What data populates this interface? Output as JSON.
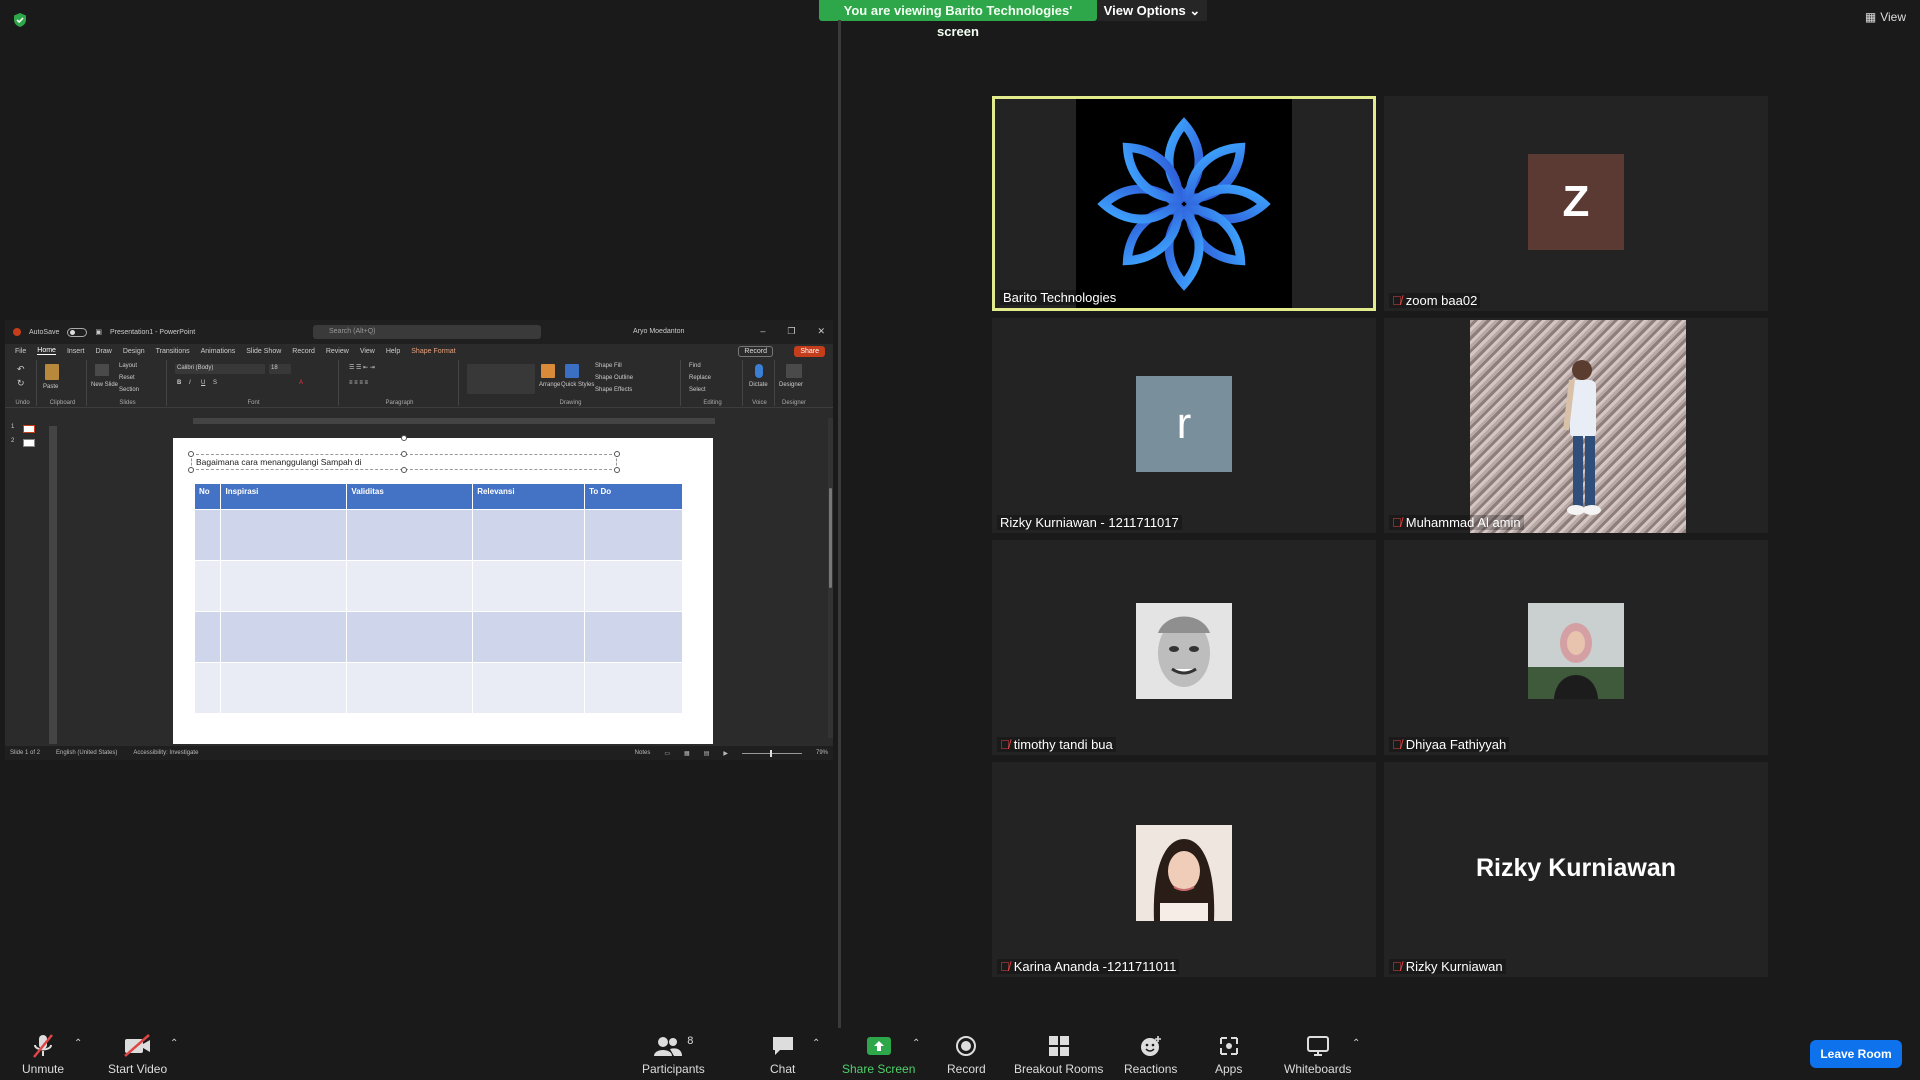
{
  "top": {
    "banner": "You are viewing Barito Technologies' screen",
    "view_options": "View Options",
    "view": "View"
  },
  "ppt": {
    "autosave": "AutoSave",
    "toggle": "Off",
    "doc_title": "Presentation1 - PowerPoint",
    "search_placeholder": "Search (Alt+Q)",
    "user": "Aryo Moedanton",
    "menu": [
      "File",
      "Home",
      "Insert",
      "Draw",
      "Design",
      "Transitions",
      "Animations",
      "Slide Show",
      "Record",
      "Review",
      "View",
      "Help",
      "Shape Format"
    ],
    "record_btn": "Record",
    "share_btn": "Share",
    "ribbon": {
      "undo": "Undo",
      "clipboard": "Clipboard",
      "paste": "Paste",
      "new_slide": "New Slide",
      "layout": "Layout",
      "reset": "Reset",
      "section": "Section",
      "slides": "Slides",
      "font_name": "Calibri (Body)",
      "font_size": "18",
      "font": "Font",
      "paragraph": "Paragraph",
      "drawing": "Drawing",
      "arrange": "Arrange",
      "quick_styles": "Quick Styles",
      "shape_fill": "Shape Fill",
      "shape_outline": "Shape Outline",
      "shape_effects": "Shape Effects",
      "find": "Find",
      "replace": "Replace",
      "select": "Select",
      "editing": "Editing",
      "dictate": "Dictate",
      "voice": "Voice",
      "designer": "Designer"
    },
    "slide_text": "Bagaimana cara menanggulangi Sampah di",
    "table_headers": [
      "No",
      "Inspirasi",
      "Validitas",
      "Relevansi",
      "To Do"
    ],
    "table_rows": 4,
    "status": {
      "slide": "Slide 1 of 2",
      "language": "English (United States)",
      "accessibility": "Accessibility: Investigate",
      "notes": "Notes",
      "zoom": "79%"
    }
  },
  "participants": [
    {
      "name": "Barito Technologies",
      "muted": false,
      "active": true
    },
    {
      "name": "zoom baa02",
      "muted": true,
      "initial": "Z",
      "color": "#5b3a33"
    },
    {
      "name": "Rizky Kurniawan - 1211711017",
      "muted": false,
      "initial": "r",
      "color": "#7a8f9c"
    },
    {
      "name": "Muhammad Al amin",
      "muted": true
    },
    {
      "name": "timothy tandi bua",
      "muted": true
    },
    {
      "name": "Dhiyaa Fathiyyah",
      "muted": true
    },
    {
      "name": "Karina Ananda -1211711011",
      "muted": true
    },
    {
      "name": "Rizky Kurniawan",
      "muted": true,
      "big_label": "Rizky Kurniawan"
    }
  ],
  "toolbar": {
    "unmute": "Unmute",
    "start_video": "Start Video",
    "participants": "Participants",
    "participants_count": "8",
    "chat": "Chat",
    "share_screen": "Share Screen",
    "record": "Record",
    "breakout_rooms": "Breakout Rooms",
    "reactions": "Reactions",
    "apps": "Apps",
    "whiteboards": "Whiteboards",
    "leave_room": "Leave Room"
  },
  "colors": {
    "share_green": "#2ea64a",
    "leave_blue": "#0e72ed",
    "active_speaker": "#e2ec8c",
    "ppt_accent": "#c43e1c",
    "table_header": "#4472c4"
  }
}
